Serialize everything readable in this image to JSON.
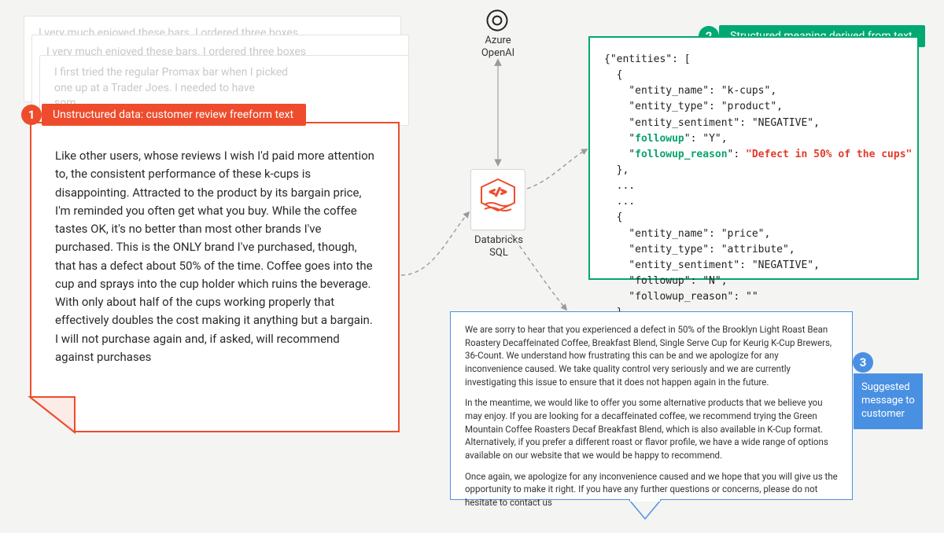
{
  "faded_text_1": "I very much enjoyed these bars. I ordered three boxes",
  "faded_text_2": "I very much enjoyed these bars. I ordered three boxes",
  "faded_text_3_line1": "I first tried the regular Promax bar when I picked",
  "faded_text_3_line2": "one up at a Trader Joes. I needed to have",
  "faded_text_3_line3": "som",
  "label1": "Unstructured data: customer review freeform text",
  "review_body": "Like other users, whose reviews I wish I'd paid more attention to, the consistent performance of these k-cups is disappointing. Attracted to the product by its bargain price, I'm reminded you often get what you buy. While the coffee tastes OK, it's no better than most other brands I've purchased. This is the ONLY brand I've purchased, though, that has a defect about 50% of the time. Coffee goes into the cup and sprays into the cup holder which ruins the beverage. With only about half of the cups working properly that effectively doubles the cost making it anything but a bargain. I will not purchase again and, if asked, will recommend against purchases",
  "openai_label": "Azure\nOpenAI",
  "center_label": "Databricks\nSQL",
  "label2": "Structured meaning derived from text",
  "json": {
    "open": "{\"entities\": [",
    "e1_open": "  {",
    "e1_name": "    \"entity_name\": \"k-cups\",",
    "e1_type": "    \"entity_type\": \"product\",",
    "e1_sent": "    \"entity_sentiment\": \"NEGATIVE\",",
    "e1_fu_key": "followup",
    "e1_fu_val": "\"Y\"",
    "e1_fr_key": "followup_reason",
    "e1_fr_val": "\"Defect in 50% of the cups\"",
    "e1_close": "  },",
    "dots1": "  ...",
    "dots2": "  ...",
    "e2_open": "  {",
    "e2_name": "    \"entity_name\": \"price\",",
    "e2_type": "    \"entity_type\": \"attribute\",",
    "e2_sent": "    \"entity_sentiment\": \"NEGATIVE\",",
    "e2_fu": "    \"followup\": \"N\",",
    "e2_fr": "    \"followup_reason\": \"\"",
    "e2_close": "  }",
    "close": "]}"
  },
  "label3": "Suggested message to customer",
  "msg_p1": "We are sorry to hear that you experienced a defect in 50% of the Brooklyn Light Roast Bean Roastery Decaffeinated Coffee, Breakfast Blend, Single Serve Cup for Keurig K-Cup Brewers, 36-Count. We understand how frustrating this can be and we apologize for any inconvenience caused. We take quality control very seriously and we are currently investigating this issue to ensure that it does not happen again in the future.",
  "msg_p2": "In the meantime, we would like to offer you some alternative products that we believe you may enjoy. If you are looking for a decaffeinated coffee, we recommend trying the Green Mountain Coffee Roasters Decaf Breakfast Blend, which is also available in K-Cup format. Alternatively, if you prefer a different roast or flavor profile, we have a wide range of options available on our website that we would be happy to recommend.",
  "msg_p3": "Once again, we apologize for any inconvenience caused and we hope that you will give us the opportunity to make it right. If you have any further questions or concerns, please do not hesitate to contact us"
}
